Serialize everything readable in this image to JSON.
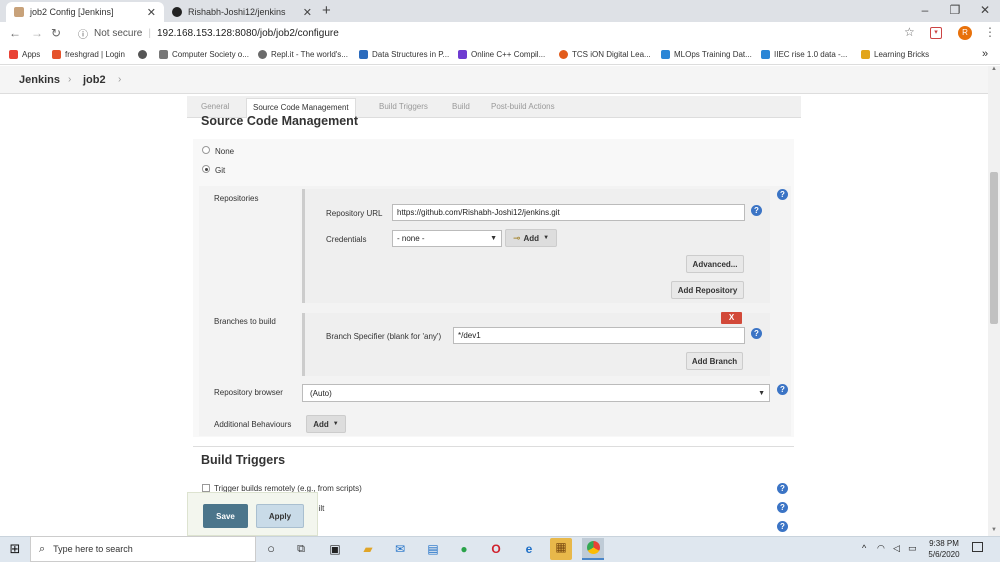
{
  "browser": {
    "tabs": [
      {
        "label": "job2 Config [Jenkins]",
        "active": true
      },
      {
        "label": "Rishabh-Joshi12/jenkins",
        "active": false
      }
    ],
    "new_tab": "+",
    "window_controls": [
      "–",
      "❐",
      "✕"
    ],
    "security": "Not secure",
    "url": "192.168.153.128:8080/job/job2/configure",
    "profile_initial": "R"
  },
  "bookmarks": [
    {
      "label": "Apps",
      "color": "#e94235"
    },
    {
      "label": "freshgrad | Login",
      "color": "#e5532b"
    },
    {
      "label": "",
      "color": "#555555"
    },
    {
      "label": "Computer Society o...",
      "color": "#777777"
    },
    {
      "label": "Repl.it - The world's...",
      "color": "#6a6a6a"
    },
    {
      "label": "Data Structures in P...",
      "color": "#2b6bbd"
    },
    {
      "label": "Online C++ Compil...",
      "color": "#6e3bd1"
    },
    {
      "label": "TCS iON Digital Lea...",
      "color": "#e25b1b"
    },
    {
      "label": "MLOps Training Dat...",
      "color": "#2b86d6"
    },
    {
      "label": "IIEC rise 1.0 data -...",
      "color": "#2b86d6"
    },
    {
      "label": "Learning Bricks",
      "color": "#e2a51b"
    }
  ],
  "bookmarks_more": "»",
  "jenkins": {
    "breadcrumb": [
      "Jenkins",
      "job2"
    ]
  },
  "config_tabs": [
    "General",
    "Source Code Management",
    "Build Triggers",
    "Build",
    "Post-build Actions"
  ],
  "scm": {
    "title": "Source Code Management",
    "options": [
      {
        "label": "None",
        "selected": false
      },
      {
        "label": "Git",
        "selected": true
      }
    ],
    "repositories_label": "Repositories",
    "repo_url_label": "Repository URL",
    "repo_url": "https://github.com/Rishabh-Joshi12/jenkins.git",
    "credentials_label": "Credentials",
    "credentials_value": "- none -",
    "add_label": "Add",
    "advanced_label": "Advanced...",
    "add_repository_label": "Add Repository",
    "branches_label": "Branches to build",
    "delete_label": "X",
    "branch_specifier_label": "Branch Specifier (blank for 'any')",
    "branch_specifier": "*/dev1",
    "add_branch_label": "Add Branch",
    "repo_browser_label": "Repository browser",
    "repo_browser_value": "(Auto)",
    "additional_behaviours_label": "Additional Behaviours",
    "behaviours_add_label": "Add"
  },
  "build_triggers": {
    "title": "Build Triggers",
    "items": [
      "Trigger builds remotely (e.g., from scripts)",
      "e built"
    ]
  },
  "actions": {
    "save": "Save",
    "apply": "Apply"
  },
  "taskbar": {
    "search_placeholder": "Type here to search",
    "time": "9:38 PM",
    "date": "5/6/2020"
  }
}
